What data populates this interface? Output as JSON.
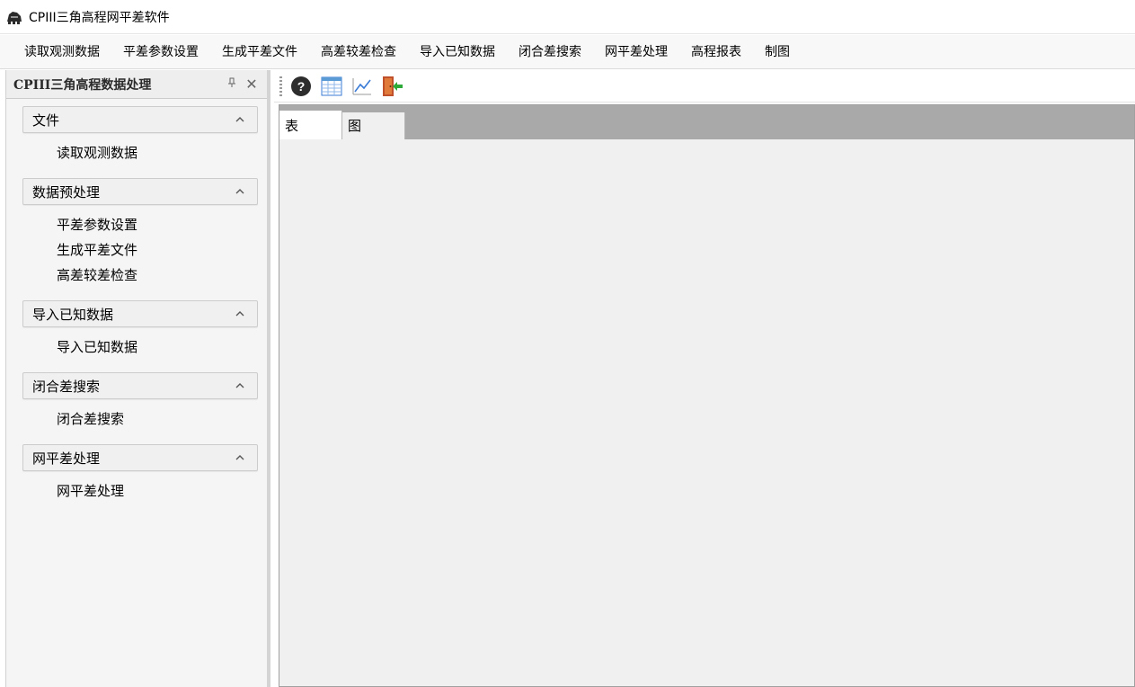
{
  "window": {
    "title": "CPIII三角高程网平差软件",
    "icon": "app-logo-icon"
  },
  "menu": {
    "items": [
      "读取观测数据",
      "平差参数设置",
      "生成平差文件",
      "高差较差检查",
      "导入已知数据",
      "闭合差搜索",
      "网平差处理",
      "高程报表",
      "制图"
    ]
  },
  "left_panel": {
    "title": "CPIII三角高程数据处理",
    "pin_glyph": "ᵖ",
    "close_glyph": "✕",
    "groups": [
      {
        "label": "文件",
        "items": [
          "读取观测数据"
        ]
      },
      {
        "label": "数据预处理",
        "items": [
          "平差参数设置",
          "生成平差文件",
          "高差较差检查"
        ]
      },
      {
        "label": "导入已知数据",
        "items": [
          "导入已知数据"
        ]
      },
      {
        "label": "闭合差搜索",
        "items": [
          "闭合差搜索"
        ]
      },
      {
        "label": "网平差处理",
        "items": [
          "网平差处理"
        ]
      }
    ]
  },
  "toolbar": {
    "buttons": [
      "help-icon",
      "table-icon",
      "chart-line-icon",
      "exit-door-icon"
    ]
  },
  "tabs": [
    {
      "label": "表",
      "active": true
    },
    {
      "label": "图",
      "active": false
    }
  ],
  "colors": {
    "tab_strip": "#a9a9a9",
    "panel_bg": "#f5f5f5",
    "content_bg": "#f0f0f0"
  }
}
